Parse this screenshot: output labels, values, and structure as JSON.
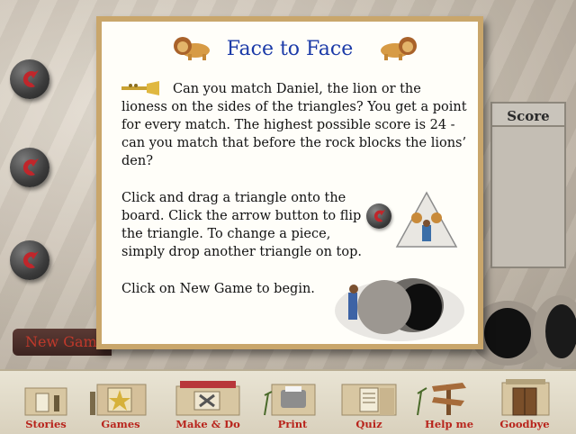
{
  "dialog": {
    "title": "Face to Face",
    "para1": "Can you match Daniel, the lion or the lioness on the sides of the triangles? You get a point for every match. The highest possible score is 24 - can you match that before the rock blocks the lions’ den?",
    "para2": "Click and drag a triangle onto the board. Click the arrow button to flip the triangle. To change a piece, simply drop another triangle on top.",
    "para3": "Click on New Game to begin."
  },
  "game": {
    "new_game_label": "New Game",
    "score_label": "Score"
  },
  "nav": {
    "items": [
      {
        "label": "Stories"
      },
      {
        "label": "Games"
      },
      {
        "label": "Make & Do"
      },
      {
        "label": "Print"
      },
      {
        "label": "Quiz"
      },
      {
        "label": "Help me"
      },
      {
        "label": "Goodbye"
      }
    ]
  },
  "colors": {
    "title": "#1b3aa8",
    "nav_label": "#b8241c",
    "arrow_red": "#c0262b",
    "dialog_frame": "#c9a66b"
  },
  "icons": [
    "rotate-arrow-icon",
    "lion-icon",
    "trumpet-icon",
    "triangle-piece-icon",
    "stone-tomb-icon"
  ]
}
